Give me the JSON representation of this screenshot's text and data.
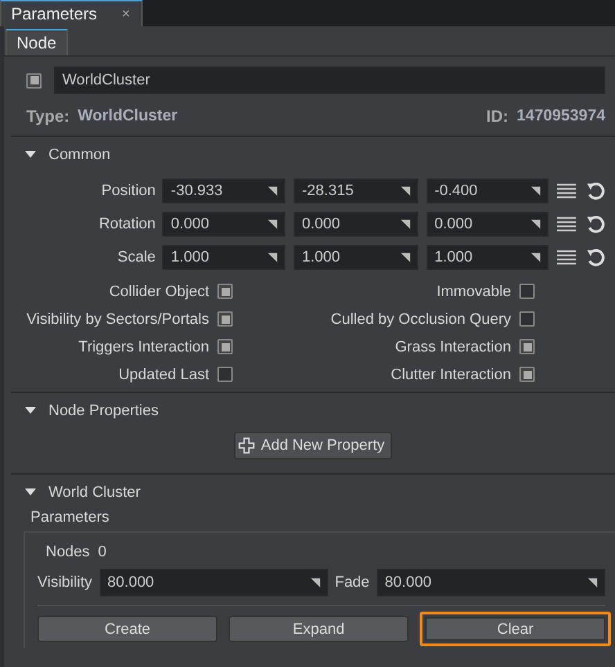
{
  "window_tabs": [
    {
      "label": "Parameters",
      "close": "×",
      "selected": true
    }
  ],
  "sub_tabs": [
    {
      "label": "Node",
      "selected": true
    }
  ],
  "node": {
    "enabled": true,
    "name": "WorldCluster",
    "type_label": "Type:",
    "type": "WorldCluster",
    "id_label": "ID:",
    "id": "1470953974"
  },
  "common": {
    "title": "Common",
    "expanded": true,
    "vectors": [
      {
        "label": "Position",
        "values": [
          "-30.933",
          "-28.315",
          "-0.400"
        ]
      },
      {
        "label": "Rotation",
        "values": [
          "0.000",
          "0.000",
          "0.000"
        ]
      },
      {
        "label": "Scale",
        "values": [
          "1.000",
          "1.000",
          "1.000"
        ]
      }
    ],
    "flags": [
      {
        "label": "Collider Object",
        "checked": true
      },
      {
        "label": "Immovable",
        "checked": false
      },
      {
        "label": "Visibility by Sectors/Portals",
        "checked": true
      },
      {
        "label": "Culled by Occlusion Query",
        "checked": false
      },
      {
        "label": "Triggers Interaction",
        "checked": true
      },
      {
        "label": "Grass Interaction",
        "checked": true
      },
      {
        "label": "Updated Last",
        "checked": false
      },
      {
        "label": "Clutter Interaction",
        "checked": true
      }
    ]
  },
  "node_properties": {
    "title": "Node Properties",
    "expanded": true,
    "button": "Add New Property"
  },
  "world_cluster": {
    "title": "World Cluster",
    "expanded": true,
    "group": "Parameters",
    "nodes_label": "Nodes",
    "nodes": "0",
    "fields": [
      {
        "label": "Visibility",
        "value": "80.000"
      },
      {
        "label": "Fade",
        "value": "80.000"
      }
    ],
    "buttons": [
      {
        "label": "Create",
        "highlighted": false
      },
      {
        "label": "Expand",
        "highlighted": false
      },
      {
        "label": "Clear",
        "highlighted": true
      }
    ]
  }
}
